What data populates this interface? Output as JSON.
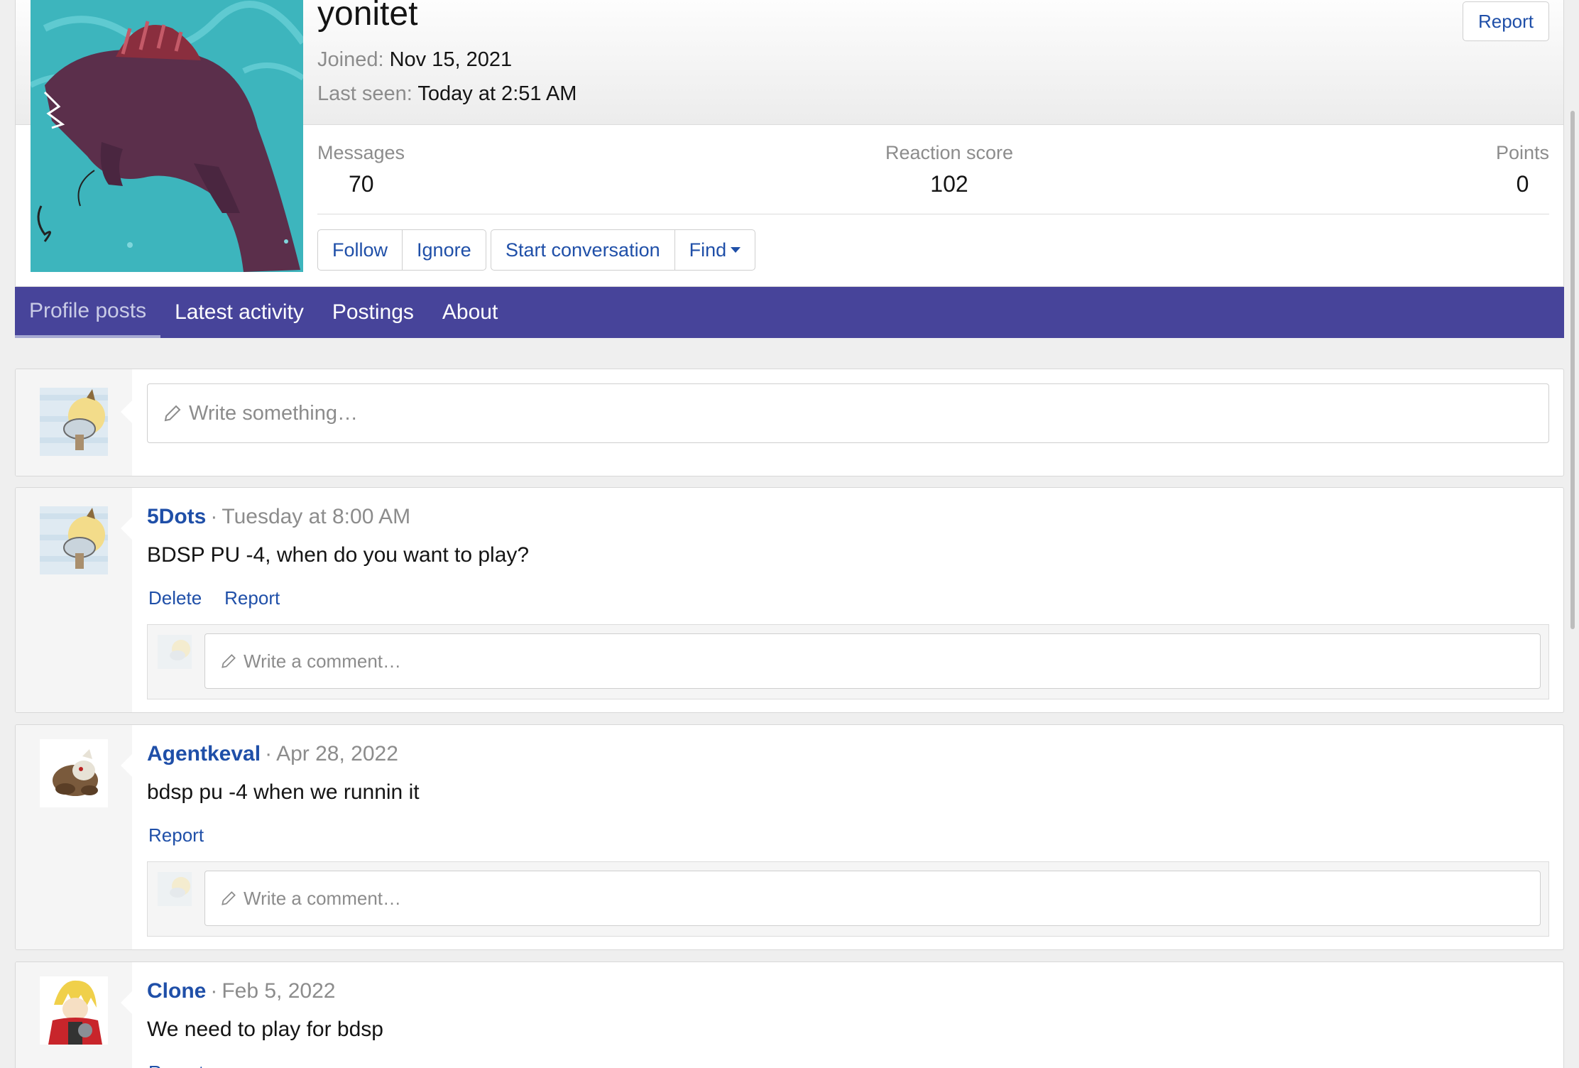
{
  "profile": {
    "username": "yonitet",
    "joined_label": "Joined:",
    "joined_value": "Nov 15, 2021",
    "last_seen_label": "Last seen:",
    "last_seen_value": "Today at 2:51 AM",
    "report_label": "Report",
    "stats": [
      {
        "label": "Messages",
        "value": "70"
      },
      {
        "label": "Reaction score",
        "value": "102"
      },
      {
        "label": "Points",
        "value": "0"
      }
    ],
    "buttons": {
      "follow": "Follow",
      "ignore": "Ignore",
      "start_conversation": "Start conversation",
      "find": "Find"
    }
  },
  "tabs": [
    {
      "label": "Profile posts",
      "active": true
    },
    {
      "label": "Latest activity",
      "active": false
    },
    {
      "label": "Postings",
      "active": false
    },
    {
      "label": "About",
      "active": false
    }
  ],
  "composer": {
    "placeholder": "Write something…"
  },
  "posts": [
    {
      "author": "5Dots",
      "time": "Tuesday at 8:00 AM",
      "body": "BDSP PU -4, when do you want to play?",
      "actions": [
        "Delete",
        "Report"
      ],
      "comment_placeholder": "Write a comment…"
    },
    {
      "author": "Agentkeval",
      "time": "Apr 28, 2022",
      "body": "bdsp pu -4 when we runnin it",
      "actions": [
        "Report"
      ],
      "comment_placeholder": "Write a comment…"
    },
    {
      "author": "Clone",
      "time": "Feb 5, 2022",
      "body": "We need to play for bdsp",
      "actions": [
        "Report"
      ]
    }
  ],
  "colors": {
    "accent_link": "#1f4fa8",
    "tab_bar": "#47449a",
    "avatar_bg": "#3db5bd"
  }
}
